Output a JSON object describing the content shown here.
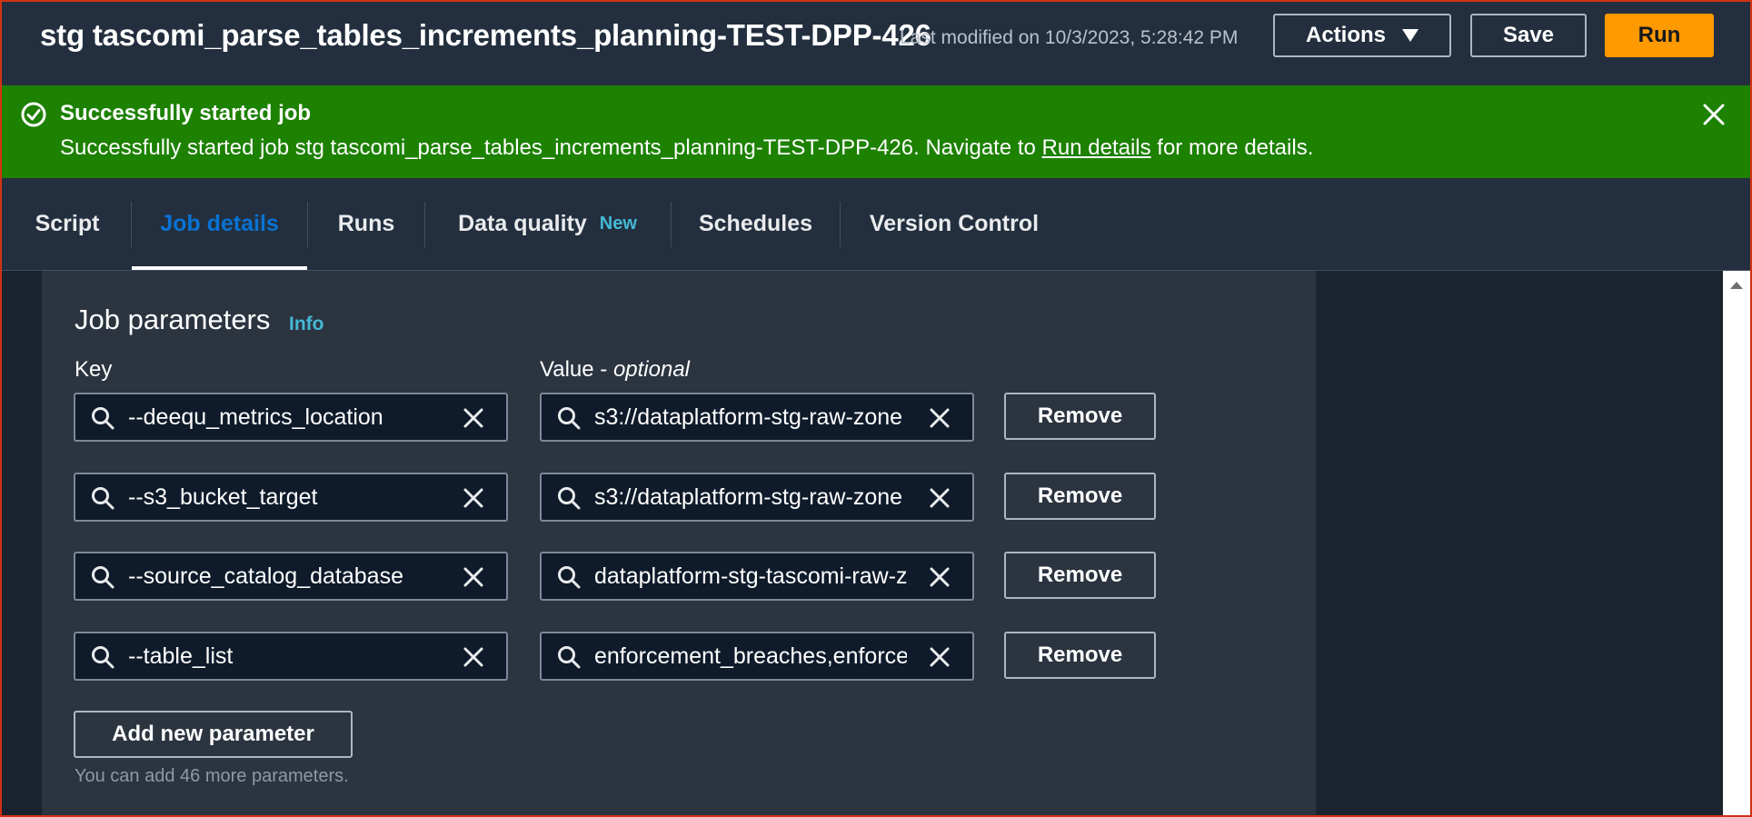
{
  "header": {
    "title": "stg tascomi_parse_tables_increments_planning-TEST-DPP-426",
    "last_modified": "Last modified on 10/3/2023, 5:28:42 PM",
    "actions_label": "Actions",
    "save_label": "Save",
    "run_label": "Run"
  },
  "flash": {
    "title": "Successfully started job",
    "message_prefix": "Successfully started job stg tascomi_parse_tables_increments_planning-TEST-DPP-426. Navigate to ",
    "link_text": "Run details",
    "message_suffix": " for more details.",
    "color": "#1d8102"
  },
  "tabs": [
    {
      "label": "Script"
    },
    {
      "label": "Job details",
      "active": true
    },
    {
      "label": "Runs"
    },
    {
      "label": "Data quality",
      "badge": "New"
    },
    {
      "label": "Schedules"
    },
    {
      "label": "Version Control"
    }
  ],
  "job_parameters": {
    "title": "Job parameters",
    "info_label": "Info",
    "key_label": "Key",
    "value_label": "Value - ",
    "value_optional": "optional",
    "rows": [
      {
        "key": "--deequ_metrics_location",
        "value": "s3://dataplatform-stg-raw-zone",
        "remove_label": "Remove"
      },
      {
        "key": "--s3_bucket_target",
        "value": "s3://dataplatform-stg-raw-zone",
        "remove_label": "Remove"
      },
      {
        "key": "--source_catalog_database",
        "value": "dataplatform-stg-tascomi-raw-z",
        "remove_label": "Remove"
      },
      {
        "key": "--table_list",
        "value": "enforcement_breaches,enforcem",
        "remove_label": "Remove"
      }
    ],
    "add_label": "Add new parameter",
    "hint": "You can add 46 more parameters."
  },
  "colors": {
    "accent": "#ff9900",
    "link": "#44b9d6",
    "active_tab": "#0972d3"
  }
}
